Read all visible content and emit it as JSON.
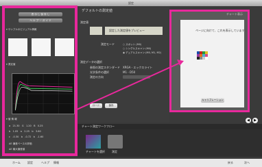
{
  "window": {
    "title": "設定"
  },
  "left_panel": {
    "top_buttons": [
      "表 示 し 保 存 し",
      "ヘ ル プ ・ ガ イ ド"
    ],
    "section_sample": "サンプルのビジュアル情報",
    "section_graph": "測定値",
    "section_values": "値 情 報",
    "value_rows": [
      [
        "a",
        "21.30",
        "G",
        "1.20",
        "B",
        "0.25"
      ],
      [
        "b",
        "1.05",
        "a",
        "2.25",
        "b",
        "3.60"
      ],
      [
        "c",
        "-0.30",
        "b",
        "-0.72",
        "b",
        "-1.60"
      ]
    ],
    "row_labels": [
      "ΔE 偏差ベースの評価",
      "ΔE 最大偏差値"
    ],
    "accent": "#e8289c"
  },
  "center_panel": {
    "header_title": "デフォルトの測定値",
    "section_1": "測定値",
    "thumb_caption": "設定した測定値をプレビュー",
    "mode_label": "測定モード",
    "radios": [
      "スポット (M0)",
      "シングルスキャン (M0)",
      "デュアルスキャン (M0, M1, M2)"
    ],
    "section_2": "測定データの選択",
    "ref_label": "参照の測定スタンダード",
    "ref_value": "XRGA - エックスライト",
    "light_label": "光学条件の選択",
    "light_value": "M1 - D50",
    "option_label": "測定の方向",
    "load_label": "ロード",
    "save_label": "保存"
  },
  "right_panel": {
    "header": "チャート表示",
    "message": "ページに向けて、これを表示しています",
    "calib_label": "キャリブレーション"
  },
  "workflow": {
    "title": "チャート測定ワークフロー",
    "item_labels": [
      "チャートを選択",
      "測定"
    ]
  },
  "dock": {
    "items": [
      "ホーム",
      "設定",
      "ヘルプ",
      "情報"
    ],
    "right_items": [
      "戻る",
      "次へ"
    ]
  }
}
